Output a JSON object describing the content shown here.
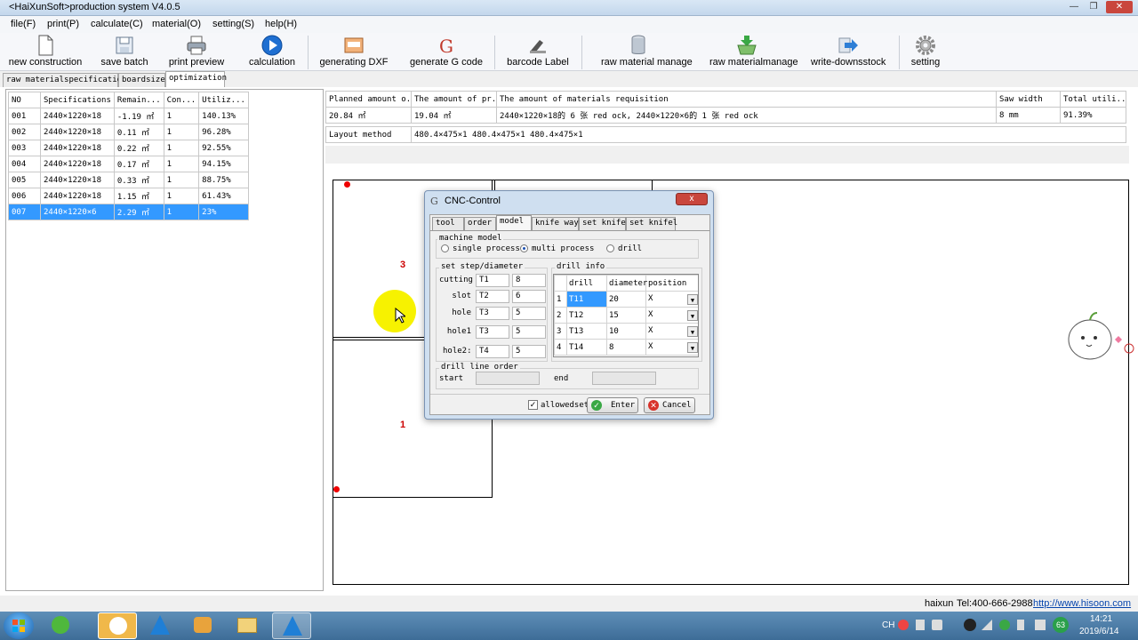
{
  "window": {
    "title": "<HaiXunSoft>production system V4.0.5"
  },
  "menu": [
    "file(F)",
    "print(P)",
    "calculate(C)",
    "material(O)",
    "setting(S)",
    "help(H)"
  ],
  "toolbar": [
    {
      "label": "new construction",
      "icon": "new-document-icon"
    },
    {
      "label": "save batch",
      "icon": "save-icon"
    },
    {
      "label": "print preview",
      "icon": "printer-icon"
    },
    {
      "label": "calculation",
      "icon": "play-icon"
    },
    {
      "label": "generating DXF",
      "icon": "dxf-icon"
    },
    {
      "label": "generate G code",
      "icon": "g-code-icon"
    },
    {
      "label": "barcode Label",
      "icon": "barcode-scanner-icon"
    },
    {
      "label": "raw material manage",
      "icon": "cylinder-icon"
    },
    {
      "label": "raw materialmanage",
      "icon": "basket-icon"
    },
    {
      "label": "write-downsstock",
      "icon": "arrow-right-icon"
    },
    {
      "label": "setting",
      "icon": "gear-icon"
    }
  ],
  "tabs": [
    "raw materialspecification",
    "boardsize",
    "optimization"
  ],
  "left_table": {
    "headers": [
      "NO",
      "Specifications",
      "Remain...",
      "Con...",
      "Utiliz..."
    ],
    "rows": [
      [
        "001",
        "2440×1220×18",
        "-1.19 ㎡",
        "1",
        "140.13%"
      ],
      [
        "002",
        "2440×1220×18",
        "0.11 ㎡",
        "1",
        "96.28%"
      ],
      [
        "003",
        "2440×1220×18",
        "0.22 ㎡",
        "1",
        "92.55%"
      ],
      [
        "004",
        "2440×1220×18",
        "0.17 ㎡",
        "1",
        "94.15%"
      ],
      [
        "005",
        "2440×1220×18",
        "0.33 ㎡",
        "1",
        "88.75%"
      ],
      [
        "006",
        "2440×1220×18",
        "1.15 ㎡",
        "1",
        "61.43%"
      ],
      [
        "007",
        "2440×1220×6",
        "2.29 ㎡",
        "1",
        "23%"
      ]
    ],
    "selected_row": 6
  },
  "summary": {
    "headers": [
      "Planned amount o...",
      "The amount of pr...",
      "The amount of materials requisition",
      "Saw width",
      "Total utili..."
    ],
    "values": [
      "20.84 ㎡",
      "19.04 ㎡",
      "2440×1220×18的 6 张 red ock, 2440×1220×6的 1 张 red ock",
      "8 mm",
      "91.39%"
    ],
    "layout_label": "Layout method",
    "layout_value": "480.4×475×1 480.4×475×1 480.4×475×1"
  },
  "canvas": {
    "part_numbers": [
      "3",
      "1"
    ]
  },
  "dialog": {
    "title": "CNC-Control",
    "close": "x",
    "tabs": [
      "tool",
      "order",
      "model",
      "knife way",
      "set knife",
      "set knifel"
    ],
    "active_tab": 2,
    "machine_model": {
      "label": "machine model",
      "options": [
        "single process",
        "multi process",
        "drill"
      ],
      "selected": 1
    },
    "step": {
      "label": "set step/diameter",
      "rows": [
        {
          "label": "cutting",
          "tool": "T1",
          "value": "8"
        },
        {
          "label": "slot",
          "tool": "T2",
          "value": "6"
        },
        {
          "label": "hole",
          "tool": "T3",
          "value": "5"
        },
        {
          "label": "hole1",
          "tool": "T3",
          "value": "5"
        },
        {
          "label": "hole2:",
          "tool": "T4",
          "value": "5"
        }
      ]
    },
    "drill_info": {
      "label": "drill info",
      "headers": [
        "drill",
        "diameter",
        "position"
      ],
      "rows": [
        {
          "n": "1",
          "drill": "T11",
          "diameter": "20",
          "position": "X"
        },
        {
          "n": "2",
          "drill": "T12",
          "diameter": "15",
          "position": "X"
        },
        {
          "n": "3",
          "drill": "T13",
          "diameter": "10",
          "position": "X"
        },
        {
          "n": "4",
          "drill": "T14",
          "diameter": "8",
          "position": "X"
        }
      ]
    },
    "drill_line": {
      "label": "drill line order",
      "start": "start",
      "end": "end"
    },
    "allowedset": "allowedset",
    "enter": "Enter",
    "cancel": "Cancel"
  },
  "status": {
    "company": "haixun",
    "tel": "Tel:400-666-2988",
    "url": "http://www.hisoon.com"
  },
  "taskbar": {
    "lang": "CH",
    "badge": "63",
    "time": "14:21",
    "date": "2019/6/14"
  },
  "colors": {
    "selection": "#3399ff",
    "part_number": "#cc0000",
    "cursor_highlight": "#f7f200"
  }
}
